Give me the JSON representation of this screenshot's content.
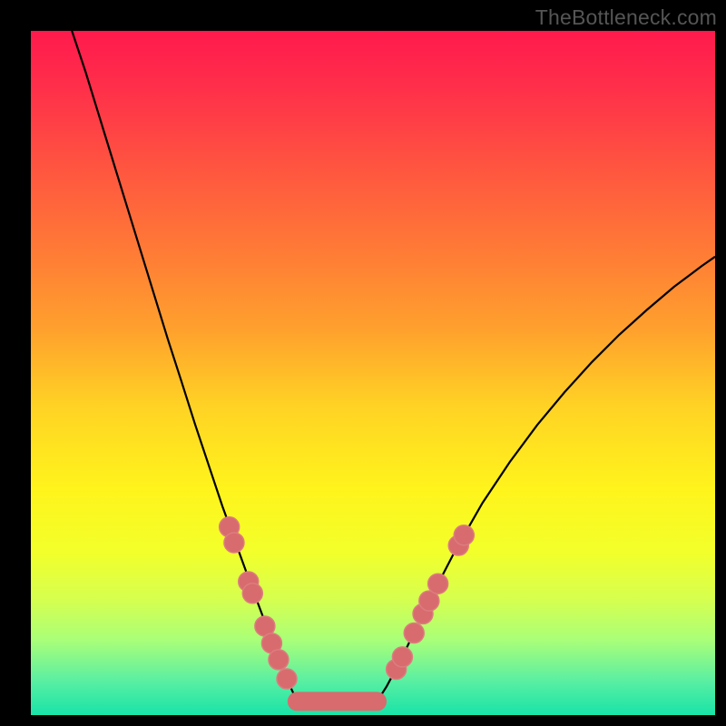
{
  "watermark": "TheBottleneck.com",
  "colors": {
    "frame": "#000000",
    "curve": "#000000",
    "marker_fill": "#d86b6e",
    "marker_stroke": "#dc7d7f",
    "gradient_top": "#ff1a4d",
    "gradient_bottom": "#18e3a8"
  },
  "chart_data": {
    "type": "line",
    "title": "",
    "xlabel": "",
    "ylabel": "",
    "xlim": [
      0,
      100
    ],
    "ylim": [
      0,
      100
    ],
    "grid": false,
    "legend": false,
    "series": [
      {
        "name": "curve-left",
        "x": [
          6,
          8,
          10,
          12,
          14,
          16,
          18,
          20,
          22,
          24,
          26,
          28,
          30,
          32,
          33.5,
          35,
          36,
          37,
          38,
          38.9
        ],
        "y": [
          100,
          94,
          87.5,
          81,
          74.5,
          68,
          61.5,
          55,
          48.8,
          42.5,
          36.5,
          30.5,
          25,
          19.5,
          15.5,
          11.5,
          9,
          6.5,
          4,
          2
        ]
      },
      {
        "name": "trough",
        "x": [
          38.9,
          41,
          43,
          45,
          47,
          49,
          50.6
        ],
        "y": [
          2,
          1.4,
          1.2,
          1.1,
          1.2,
          1.4,
          2
        ]
      },
      {
        "name": "curve-right",
        "x": [
          50.6,
          52,
          53.5,
          55,
          57,
          59,
          62,
          66,
          70,
          74,
          78,
          82,
          86,
          90,
          94,
          98,
          100
        ],
        "y": [
          2,
          4.2,
          7,
          10,
          14.2,
          18.2,
          24,
          31,
          37,
          42.4,
          47.2,
          51.6,
          55.6,
          59.2,
          62.6,
          65.6,
          67
        ]
      }
    ],
    "markers": {
      "name": "highlighted-points",
      "points": [
        {
          "x": 29.0,
          "y": 27.5
        },
        {
          "x": 29.7,
          "y": 25.2
        },
        {
          "x": 31.8,
          "y": 19.5
        },
        {
          "x": 32.4,
          "y": 17.8
        },
        {
          "x": 34.2,
          "y": 13.0
        },
        {
          "x": 35.2,
          "y": 10.5
        },
        {
          "x": 36.2,
          "y": 8.1
        },
        {
          "x": 37.4,
          "y": 5.3
        },
        {
          "x": 53.4,
          "y": 6.7
        },
        {
          "x": 54.3,
          "y": 8.5
        },
        {
          "x": 56.0,
          "y": 12.0
        },
        {
          "x": 57.3,
          "y": 14.8
        },
        {
          "x": 58.2,
          "y": 16.7
        },
        {
          "x": 59.5,
          "y": 19.2
        },
        {
          "x": 62.5,
          "y": 24.8
        },
        {
          "x": 63.3,
          "y": 26.3
        }
      ],
      "radius": 11
    },
    "trough_bar": {
      "x0": 38.9,
      "x1": 50.6,
      "y": 2.0
    }
  }
}
